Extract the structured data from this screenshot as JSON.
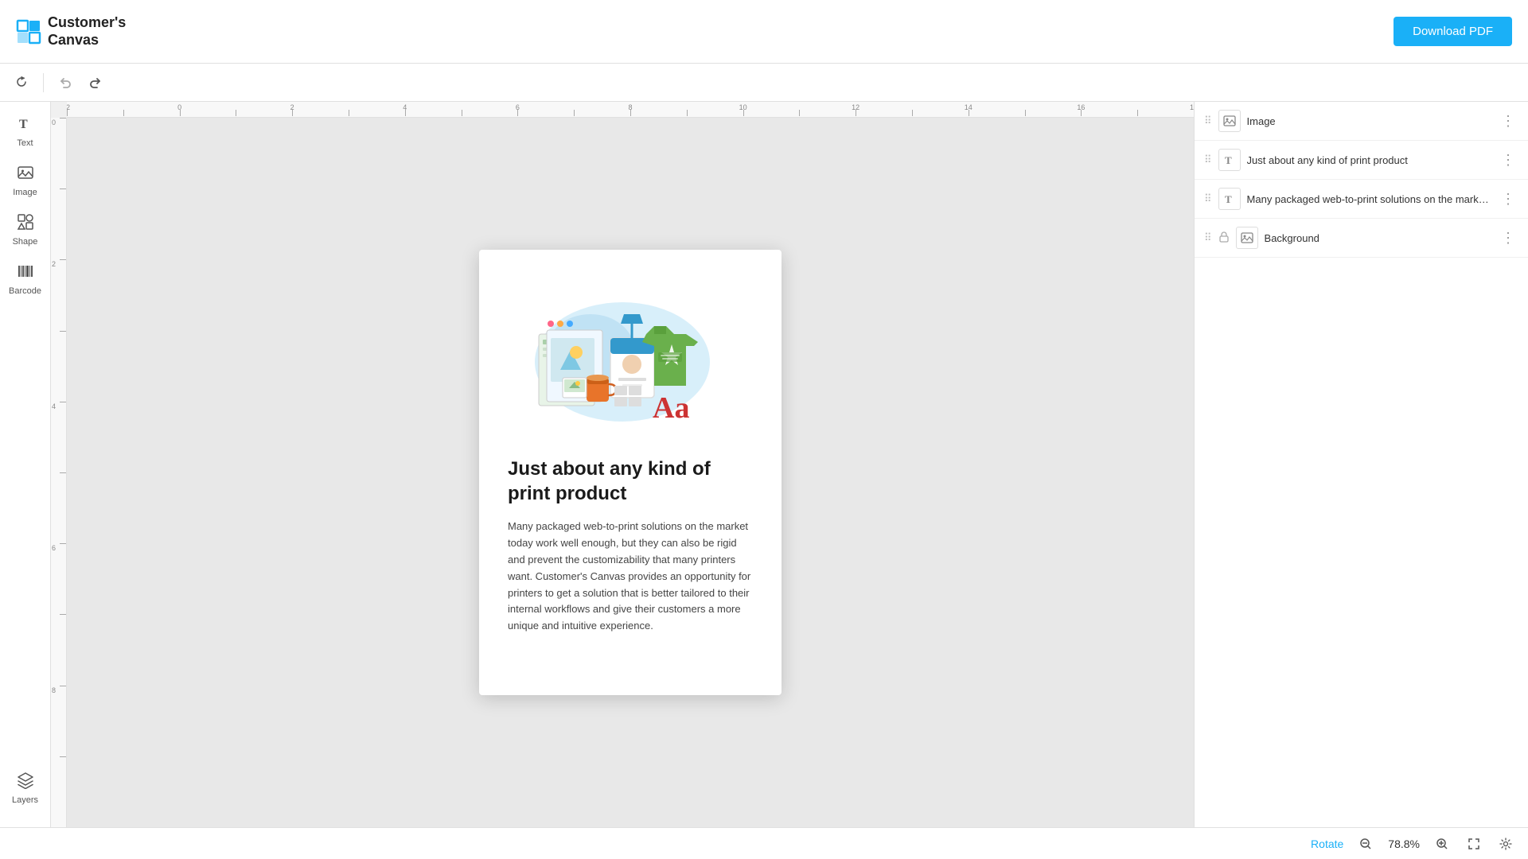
{
  "header": {
    "logo_text_line1": "Customer's",
    "logo_text_line2": "Canvas",
    "download_button_label": "Download PDF"
  },
  "toolbar": {
    "undo_label": "Undo",
    "redo_label": "Redo"
  },
  "left_sidebar": {
    "tools": [
      {
        "id": "text",
        "label": "Text",
        "icon": "T"
      },
      {
        "id": "image",
        "label": "Image",
        "icon": "IMG"
      },
      {
        "id": "shape",
        "label": "Shape",
        "icon": "SHP"
      },
      {
        "id": "barcode",
        "label": "Barcode",
        "icon": "BAR"
      }
    ],
    "layers_label": "Layers"
  },
  "canvas": {
    "document": {
      "title": "Just about any kind of print product",
      "body": "Many packaged web-to-print solutions on the market today work well enough, but they can also be rigid and prevent the customizability that many printers want. Customer's Canvas provides an opportunity for printers to get a solution that is better tailored to their internal workflows and give their customers a more unique and intuitive experience."
    }
  },
  "layers_panel": {
    "items": [
      {
        "id": "image-layer",
        "type": "image",
        "name": "Image",
        "locked": false
      },
      {
        "id": "text-layer-1",
        "type": "text",
        "name": "Just about any kind of print product",
        "locked": false
      },
      {
        "id": "text-layer-2",
        "type": "text",
        "name": "Many packaged web-to-print solutions on the market today work well eno...",
        "locked": false
      },
      {
        "id": "background-layer",
        "type": "image",
        "name": "Background",
        "locked": true
      }
    ]
  },
  "status_bar": {
    "rotate_label": "Rotate",
    "zoom_value": "78.8%"
  }
}
